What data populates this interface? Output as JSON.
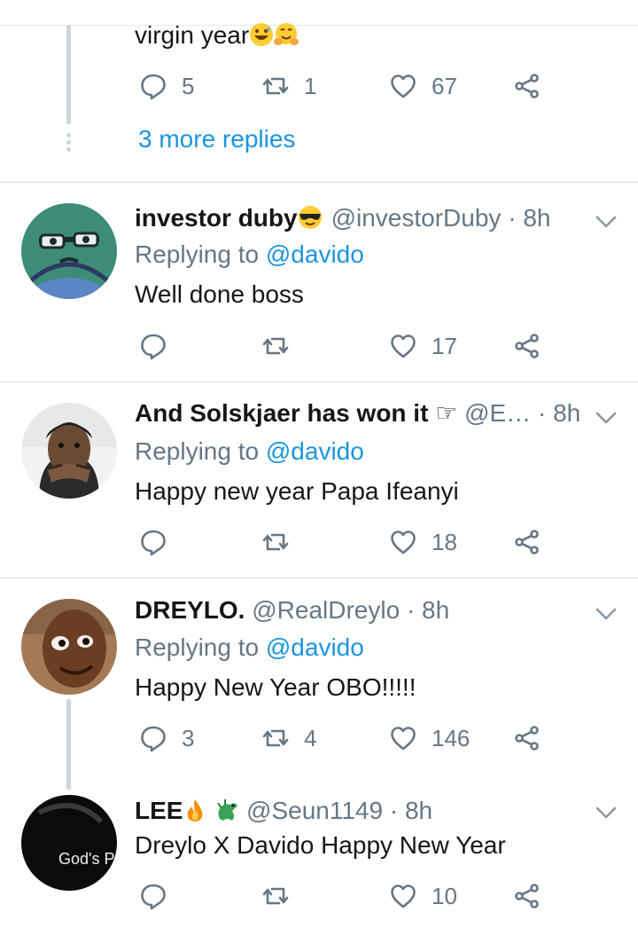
{
  "top_fragment": {
    "text": "virgin year",
    "reply_count": "5",
    "retweet_count": "1",
    "like_count": "67",
    "more_replies": "3 more replies"
  },
  "tweets": [
    {
      "name": "investor duby",
      "handle": "@investorDuby",
      "time": "· 8h",
      "replying_label": "Replying to",
      "replying_handle": "@davido",
      "text": "Well done boss",
      "reply_count": "",
      "retweet_count": "",
      "like_count": "17"
    },
    {
      "name": "And Solskjaer has won it",
      "handle": "@E…",
      "time": "· 8h",
      "replying_label": "Replying to",
      "replying_handle": "@davido",
      "text": "Happy new year Papa Ifeanyi",
      "reply_count": "",
      "retweet_count": "",
      "like_count": "18"
    },
    {
      "name": "DREYLO.",
      "handle": "@RealDreylo",
      "time": "· 8h",
      "replying_label": "Replying to",
      "replying_handle": "@davido",
      "text": "Happy New Year OBO!!!!!",
      "reply_count": "3",
      "retweet_count": "4",
      "like_count": "146"
    },
    {
      "name": "LEE",
      "handle": "@Seun1149",
      "time": "· 8h",
      "text": "Dreylo X Davido Happy New Year",
      "reply_count": "",
      "retweet_count": "",
      "like_count": "10",
      "avatar_text": "God's Plan"
    }
  ],
  "colors": {
    "link": "#1b95e0",
    "secondary": "#657786",
    "primary": "#14171a",
    "divider": "#e1e8ed"
  }
}
